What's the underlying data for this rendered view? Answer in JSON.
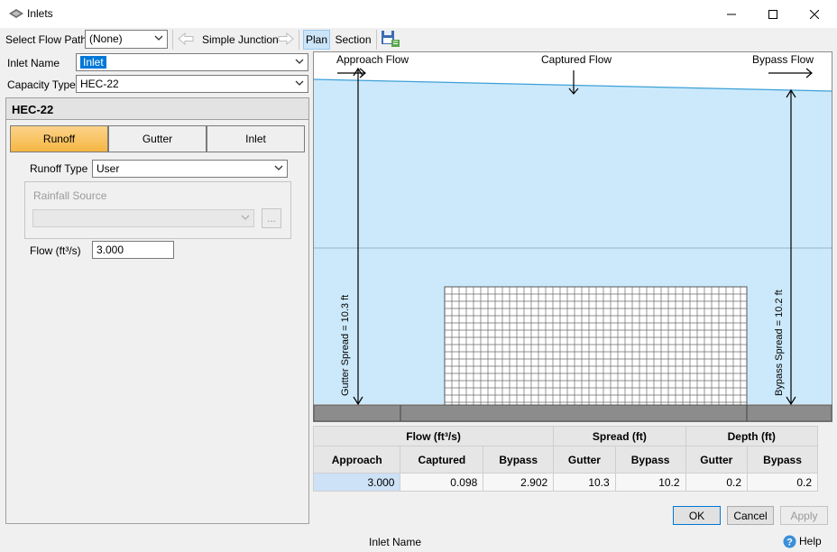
{
  "window": {
    "title": "Inlets"
  },
  "toolbar": {
    "flow_path_label": "Select Flow Path",
    "flow_path_value": "(None)",
    "junction_label": "Simple Junction",
    "plan_label": "Plan",
    "section_label": "Section"
  },
  "inlet": {
    "name_label": "Inlet Name",
    "name_value": "Inlet",
    "capacity_label": "Capacity Type",
    "capacity_value": "HEC-22",
    "section_title": "HEC-22",
    "tabs": [
      "Runoff",
      "Gutter",
      "Inlet"
    ],
    "runoff_type_label": "Runoff Type",
    "runoff_type_value": "User",
    "rainfall_label": "Rainfall Source",
    "rainfall_value": "",
    "browse_label": "...",
    "flow_label": "Flow (ft³/s)",
    "flow_value": "3.000"
  },
  "plan": {
    "approach_label": "Approach Flow",
    "captured_label": "Captured Flow",
    "bypass_label": "Bypass Flow",
    "gutter_spread_label": "Gutter Spread = 10.3 ft",
    "bypass_spread_label": "Bypass Spread = 10.2 ft",
    "colors": {
      "water": "#cce9fb",
      "line": "#3ca0d8",
      "curb": "#8c8c8c"
    }
  },
  "results": {
    "group_headers": [
      "Flow (ft³/s)",
      "Spread (ft)",
      "Depth (ft)"
    ],
    "col_headers": [
      "Approach",
      "Captured",
      "Bypass",
      "Gutter",
      "Bypass",
      "Gutter",
      "Bypass"
    ],
    "row": [
      "3.000",
      "0.098",
      "2.902",
      "10.3",
      "10.2",
      "0.2",
      "0.2"
    ]
  },
  "buttons": {
    "ok": "OK",
    "cancel": "Cancel",
    "apply": "Apply",
    "help": "Help"
  },
  "status": {
    "text": "Inlet Name"
  }
}
